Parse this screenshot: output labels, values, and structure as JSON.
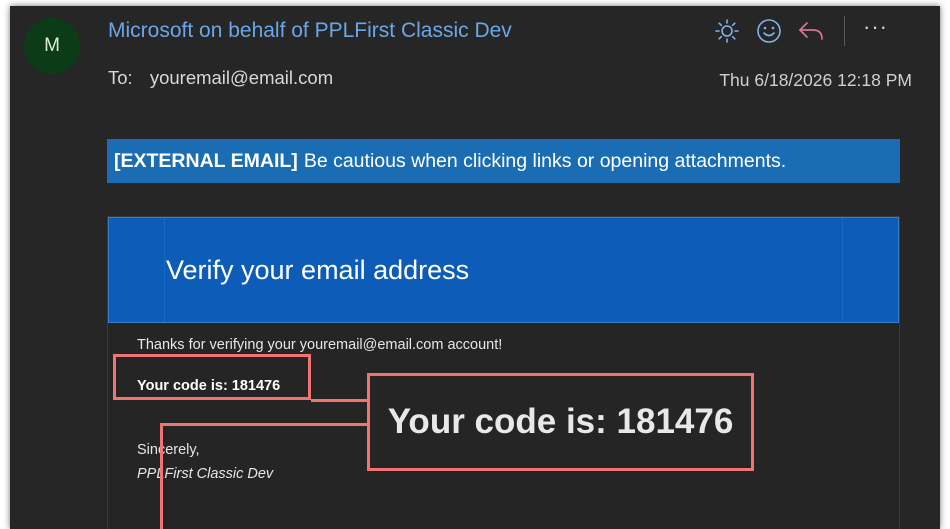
{
  "header": {
    "avatar_initial": "M",
    "sender": "Microsoft on behalf of PPLFirst Classic Dev",
    "to_label": "To:",
    "to_address": "youremail@email.com",
    "date": "Thu 6/18/2026 12:18 PM"
  },
  "toolbar": {
    "icons": [
      "brightness-icon",
      "emoji-icon",
      "reply-icon",
      "more-icon"
    ],
    "more_label": "···"
  },
  "banner": {
    "tag": "[EXTERNAL EMAIL]",
    "text": "Be cautious when clicking links or opening attachments."
  },
  "email_body": {
    "title": "Verify your email address",
    "thanks": "Thanks for verifying your youremail@email.com account!",
    "code_line": "Your code is: 181476",
    "sincerely": "Sincerely,",
    "signature": "PPLFirst Classic Dev"
  },
  "callout": {
    "code_line": "Your code is: 181476",
    "highlight_color": "#ef7472"
  },
  "colors": {
    "background": "#262626",
    "sender_link": "#6ba6e8",
    "banner": "#1b6db3",
    "card_header": "#0d5db8",
    "avatar": "#0c3c17"
  }
}
